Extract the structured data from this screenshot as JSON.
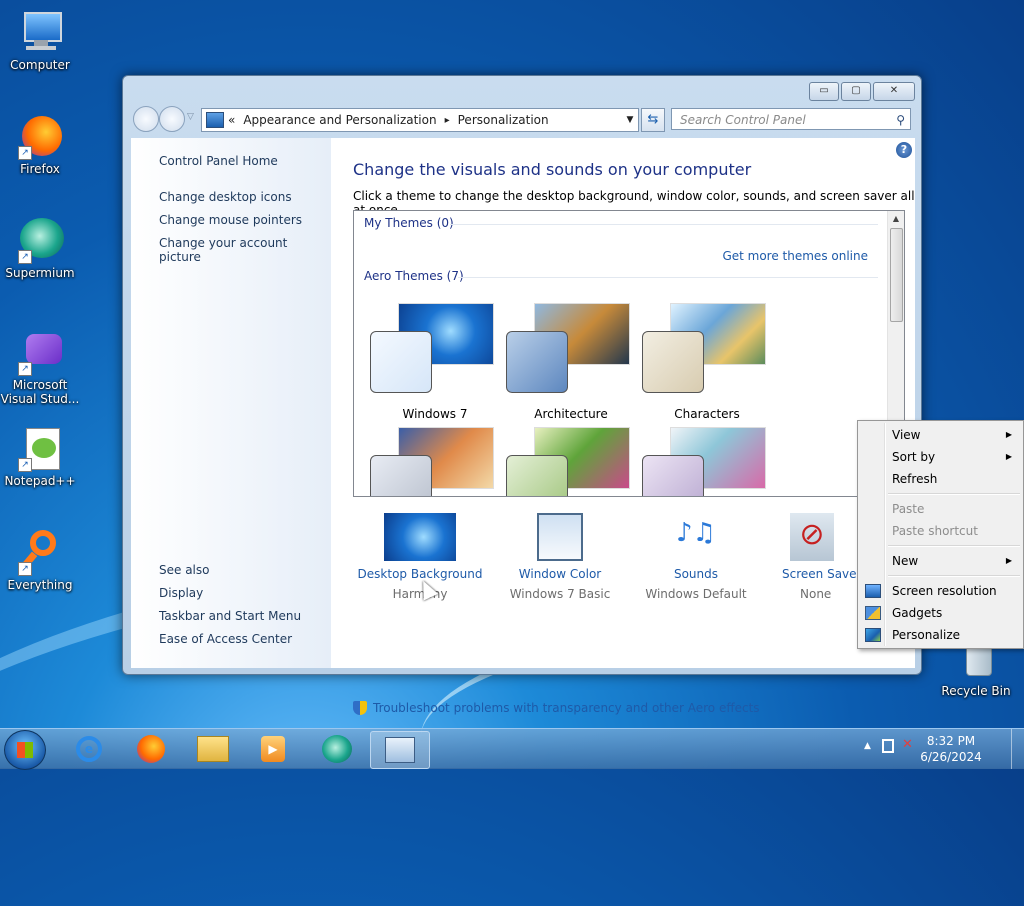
{
  "desktop": {
    "icons": [
      {
        "label": "Computer"
      },
      {
        "label": "Firefox"
      },
      {
        "label": "Supermium"
      },
      {
        "label": "Microsoft Visual Stud..."
      },
      {
        "label": "Notepad++"
      },
      {
        "label": "Everything"
      },
      {
        "label": "Recycle Bin"
      }
    ]
  },
  "window": {
    "controls": {
      "minimize": "▭",
      "maximize": "▢",
      "close": "✕"
    },
    "address": {
      "chevrons": "«",
      "crumb1": "Appearance and Personalization",
      "sep": "▸",
      "crumb2": "Personalization"
    },
    "search_placeholder": "Search Control Panel",
    "left_pane": {
      "home": "Control Panel Home",
      "links": [
        "Change desktop icons",
        "Change mouse pointers",
        "Change your account picture"
      ],
      "see_also_title": "See also",
      "see_also": [
        "Display",
        "Taskbar and Start Menu",
        "Ease of Access Center"
      ]
    },
    "main": {
      "heading": "Change the visuals and sounds on your computer",
      "subheading": "Click a theme to change the desktop background, window color, sounds, and screen saver all at once.",
      "my_themes": "My Themes (0)",
      "get_more": "Get more themes online",
      "aero_themes": "Aero Themes (7)",
      "themes": [
        {
          "name": "Windows 7"
        },
        {
          "name": "Architecture"
        },
        {
          "name": "Characters"
        }
      ],
      "settings": [
        {
          "title": "Desktop Background",
          "value": "Harmony"
        },
        {
          "title": "Window Color",
          "value": "Windows 7 Basic"
        },
        {
          "title": "Sounds",
          "value": "Windows Default"
        },
        {
          "title": "Screen Saver",
          "value": "None"
        }
      ],
      "troubleshoot": "Troubleshoot problems with transparency and other Aero effects"
    }
  },
  "context_menu": {
    "items": [
      {
        "label": "View",
        "submenu": "▶"
      },
      {
        "label": "Sort by",
        "submenu": "▶"
      },
      {
        "label": "Refresh"
      },
      {
        "label": "Paste"
      },
      {
        "label": "Paste shortcut"
      },
      {
        "label": "New",
        "submenu": "▶"
      },
      {
        "label": "Screen resolution"
      },
      {
        "label": "Gadgets"
      },
      {
        "label": "Personalize"
      }
    ]
  },
  "taskbar": {
    "time": "8:32 PM",
    "date": "6/26/2024"
  },
  "colors": {
    "link": "#1e5aa8",
    "heading": "#1e3287"
  }
}
